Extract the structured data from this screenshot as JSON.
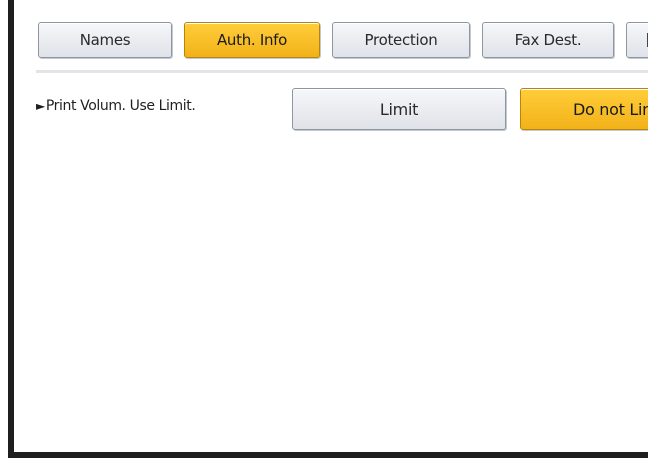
{
  "tabs": [
    {
      "label": "Names",
      "selected": false
    },
    {
      "label": "Auth. Info",
      "selected": true
    },
    {
      "label": "Protection",
      "selected": false
    },
    {
      "label": "Fax Dest.",
      "selected": false
    },
    {
      "label": "",
      "selected": false
    }
  ],
  "setting": {
    "marker": "►",
    "label": "Print Volum. Use Limit.",
    "options": [
      {
        "label": "Limit",
        "selected": false
      },
      {
        "label": "Do not Lim",
        "selected": true
      }
    ]
  },
  "colors": {
    "selected_fill": "#f2b219",
    "normal_fill": "#e6e8ed",
    "frame": "#1f1f1f"
  }
}
